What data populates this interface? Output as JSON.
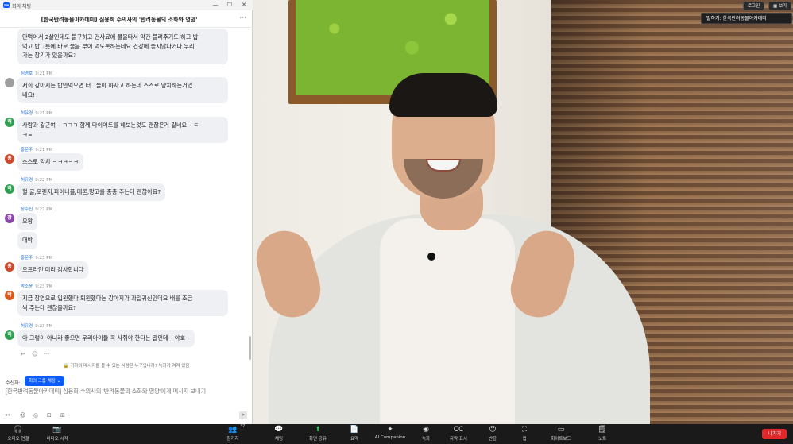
{
  "window": {
    "title": "회의 채팅",
    "logo_text": "zm",
    "minimize": "—",
    "maximize": "☐",
    "close": "✕"
  },
  "chat": {
    "header_title": "[한국반려동물아카데미] 심용희 수의사의 '반려동물의 소화와 영양'",
    "more": "···",
    "messages": [
      {
        "sender": "",
        "time": "",
        "initial": "",
        "color": "",
        "lines": [
          "안먹어서 2살인데도 불구하고 건사료에 물을타서 약간 불려주기도 하고 밥",
          "먹고 밥그릇에 바로 물을 부어 먹도록하는데요 건강에 좋지않다거나 우리",
          "가는 장기가 있을까요?"
        ]
      },
      {
        "sender": "심명호",
        "time": "9:21 PM",
        "initial": "",
        "color": "#9e9e9e",
        "lines": [
          "저희 강아지는 밥만먹으면 터그놀이 하자고 하는데 스스로 양치하는거였",
          "네요!"
        ]
      },
      {
        "sender": "허유경",
        "time": "9:21 PM",
        "initial": "허",
        "color": "#2e9e4f",
        "lines": [
          "사람과 같군여~ ㅋㅋㅋ 함께 다이어트를 해보는것도 괜찮은거 같네요~ ㅌ",
          "ㅋㅌ"
        ]
      },
      {
        "sender": "홍문주",
        "time": "9:21 PM",
        "initial": "홍",
        "color": "#d2452b",
        "lines": [
          "스스로 양치 ㅋㅋㅋㅋㅋ"
        ]
      },
      {
        "sender": "허유경",
        "time": "9:22 PM",
        "initial": "허",
        "color": "#2e9e4f",
        "lines": [
          "헐 귤,오렌지,파이네플,메론,망고를 종종 주는데 괜찮아요?"
        ]
      },
      {
        "sender": "장수진",
        "time": "9:22 PM",
        "initial": "장",
        "color": "#8e44ad",
        "lines": [
          "오왕"
        ]
      },
      {
        "sender": "",
        "time": "",
        "initial": "",
        "color": "",
        "lines": [
          "대박"
        ]
      },
      {
        "sender": "홍문주",
        "time": "9:23 PM",
        "initial": "홍",
        "color": "#d2452b",
        "lines": [
          "오프라인 미리 감사합니다"
        ]
      },
      {
        "sender": "박소윤",
        "time": "9:23 PM",
        "initial": "박",
        "color": "#d9591e",
        "lines": [
          "지금 장염으로 입원했다 퇴원했다는 강아지가 과일귀신인데요 배를 조금",
          "씩 주는데 괜찮을까요?"
        ]
      },
      {
        "sender": "허유경",
        "time": "9:23 PM",
        "initial": "허",
        "color": "#2e9e4f",
        "lines": [
          "아 그렇이 아니라 좋으면 우리아이들 꼭 사줘야 한다는 말인데~ 야호~"
        ]
      }
    ],
    "reaction_icons": [
      "↩",
      "☺",
      "···"
    ],
    "notice": "🔒 귀하의 메시지를 볼 수 있는 사람은 누구입니까? 녹화가 켜져 있음",
    "recipient_label": "수신자:",
    "recipient_value": "회의 그룹 채팅 ⌄",
    "input_placeholder": "[한국반려동물아카데미] 심용희 수의사의 '반려동물의 소화와 영양'에게 메시지 보내기",
    "composer_tools": [
      "✂",
      "☺",
      "◎",
      "⊡",
      "⊞"
    ],
    "send": "➤"
  },
  "video": {
    "login_btn": "로그인",
    "view_btn": "▦ 보기",
    "speaker": "말하기: 한국반려동물아카데미"
  },
  "toolbar": {
    "items": [
      {
        "key": "audio",
        "icon": "🎧",
        "label": "오디오 연결"
      },
      {
        "key": "video",
        "icon": "📷",
        "label": "비디오 시작"
      },
      {
        "key": "participants",
        "icon": "👥",
        "label": "참가자",
        "badge": "37"
      },
      {
        "key": "chat",
        "icon": "💬",
        "label": "채팅"
      },
      {
        "key": "share",
        "icon": "⬆",
        "label": "화면 공유"
      },
      {
        "key": "summary",
        "icon": "📄",
        "label": "요약"
      },
      {
        "key": "ai",
        "icon": "✦",
        "label": "AI Companion"
      },
      {
        "key": "record",
        "icon": "◉",
        "label": "녹화"
      },
      {
        "key": "cc",
        "icon": "CC",
        "label": "자막 표시"
      },
      {
        "key": "react",
        "icon": "☺",
        "label": "반응"
      },
      {
        "key": "apps",
        "icon": "⛶",
        "label": "앱"
      },
      {
        "key": "whiteboard",
        "icon": "▭",
        "label": "화이트보드"
      },
      {
        "key": "notes",
        "icon": "🗒",
        "label": "노트"
      }
    ],
    "leave": "나가기"
  }
}
